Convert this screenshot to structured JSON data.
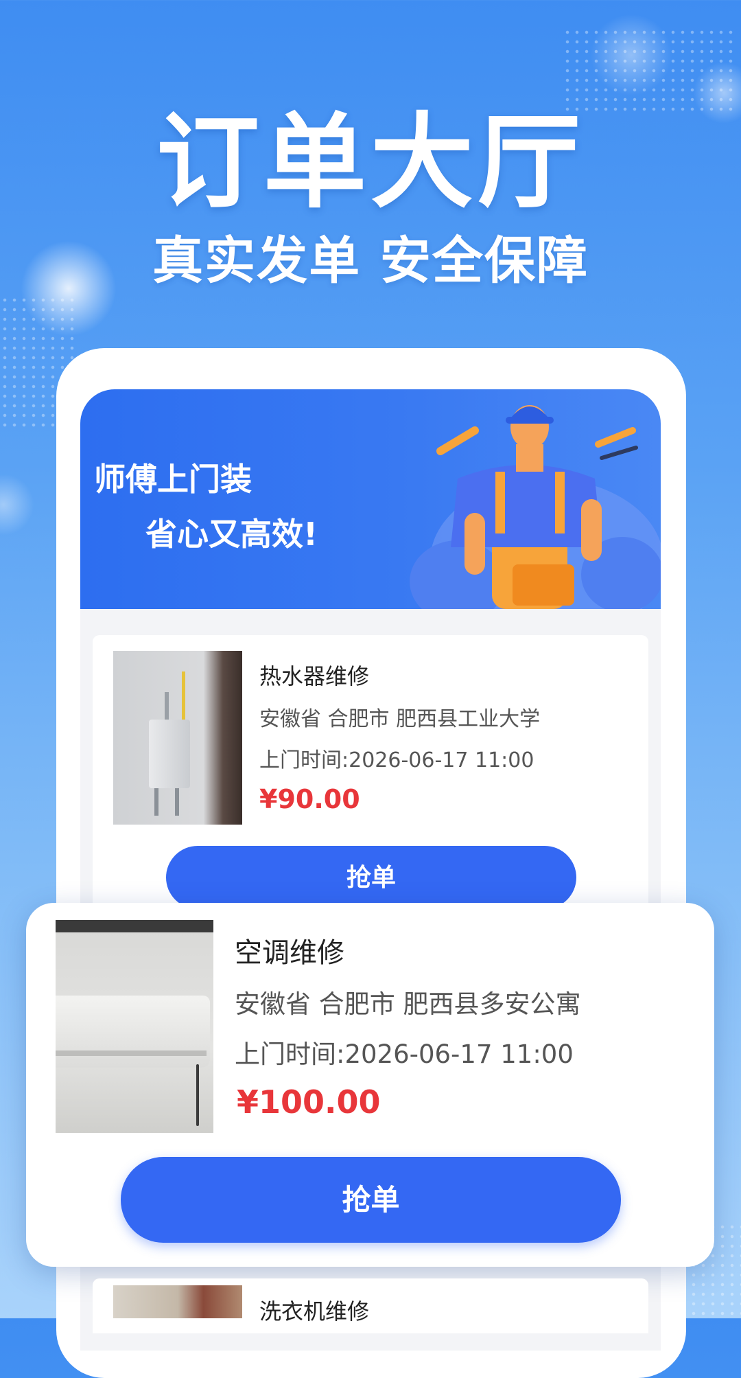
{
  "hero": {
    "title": "订单大厅",
    "subtitle": "真实发单  安全保障"
  },
  "banner": {
    "line1": "师傅上门装",
    "line2": "省心又高效!"
  },
  "orders": [
    {
      "title": "热水器维修",
      "address": "安徽省 合肥市 肥西县工业大学",
      "time": "上门时间:2026-06-17 11:00",
      "price": "¥90.00",
      "button": "抢单",
      "image_icon": "water-heater-photo"
    },
    {
      "title": "空调维修",
      "address": "安徽省 合肥市 肥西县多安公寓",
      "time": "上门时间:2026-06-17 11:00",
      "price": "¥100.00",
      "button": "抢单",
      "image_icon": "air-conditioner-photo"
    },
    {
      "title": "洗衣机维修",
      "image_icon": "washing-machine-photo"
    }
  ],
  "colors": {
    "accent": "#3468f3",
    "price": "#e8363a",
    "background_top": "#3f8df2",
    "background_bottom": "#a9d3fb"
  }
}
